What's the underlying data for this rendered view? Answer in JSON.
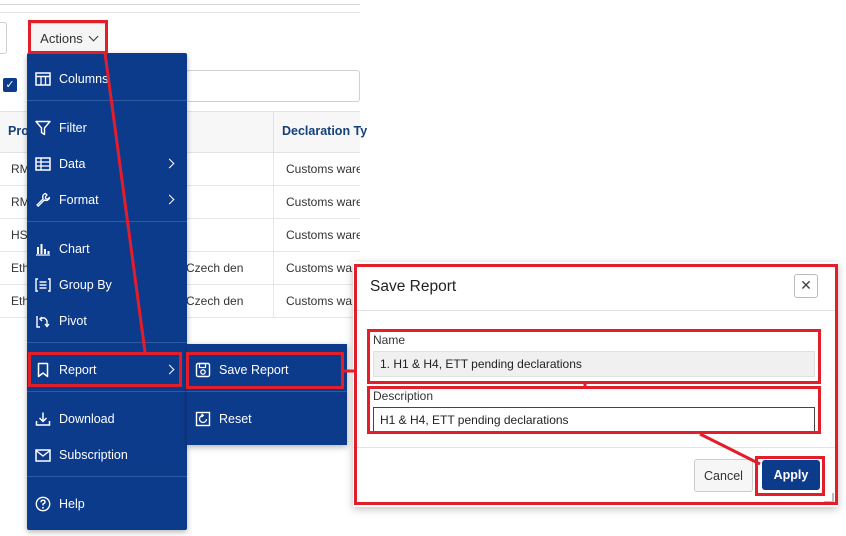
{
  "toolbar": {
    "actions_label": "Actions"
  },
  "report": {
    "headers": [
      "Pro",
      "Declaration Ty"
    ],
    "rows": [
      {
        "c1": "RM",
        "c2": "",
        "c3": "Customs ware"
      },
      {
        "c1": "RM",
        "c2": "",
        "c3": "Customs ware"
      },
      {
        "c1": "HS",
        "c2": "",
        "c3": "Customs ware"
      },
      {
        "c1": "Eth",
        "c2": "o Czech den",
        "c3": "Customs wa"
      },
      {
        "c1": "Eth",
        "c2": "o Czech den",
        "c3": "Customs wa"
      }
    ]
  },
  "actions_menu": {
    "items": [
      {
        "label": "Columns",
        "icon": "columns-icon"
      },
      {
        "label": "Filter",
        "icon": "filter-icon"
      },
      {
        "label": "Data",
        "icon": "table-icon"
      },
      {
        "label": "Format",
        "icon": "wrench-icon"
      },
      {
        "label": "Chart",
        "icon": "bar-chart-icon"
      },
      {
        "label": "Group By",
        "icon": "group-by-icon"
      },
      {
        "label": "Pivot",
        "icon": "pivot-icon"
      },
      {
        "label": "Report",
        "icon": "bookmark-icon"
      },
      {
        "label": "Download",
        "icon": "download-icon"
      },
      {
        "label": "Subscription",
        "icon": "envelope-icon"
      },
      {
        "label": "Help",
        "icon": "help-icon"
      }
    ]
  },
  "report_submenu": {
    "items": [
      {
        "label": "Save Report",
        "icon": "save-icon"
      },
      {
        "label": "Reset",
        "icon": "reset-icon"
      }
    ]
  },
  "dialog": {
    "title": "Save Report",
    "close_glyph": "✕",
    "name_label": "Name",
    "name_value": "1. H1 & H4, ETT pending declarations",
    "description_label": "Description",
    "description_value": "H1 & H4, ETT pending declarations",
    "cancel_label": "Cancel",
    "apply_label": "Apply"
  },
  "colors": {
    "menu_bg": "#0d3b8c",
    "highlight": "#e31d2a",
    "header_text": "#13407a"
  }
}
